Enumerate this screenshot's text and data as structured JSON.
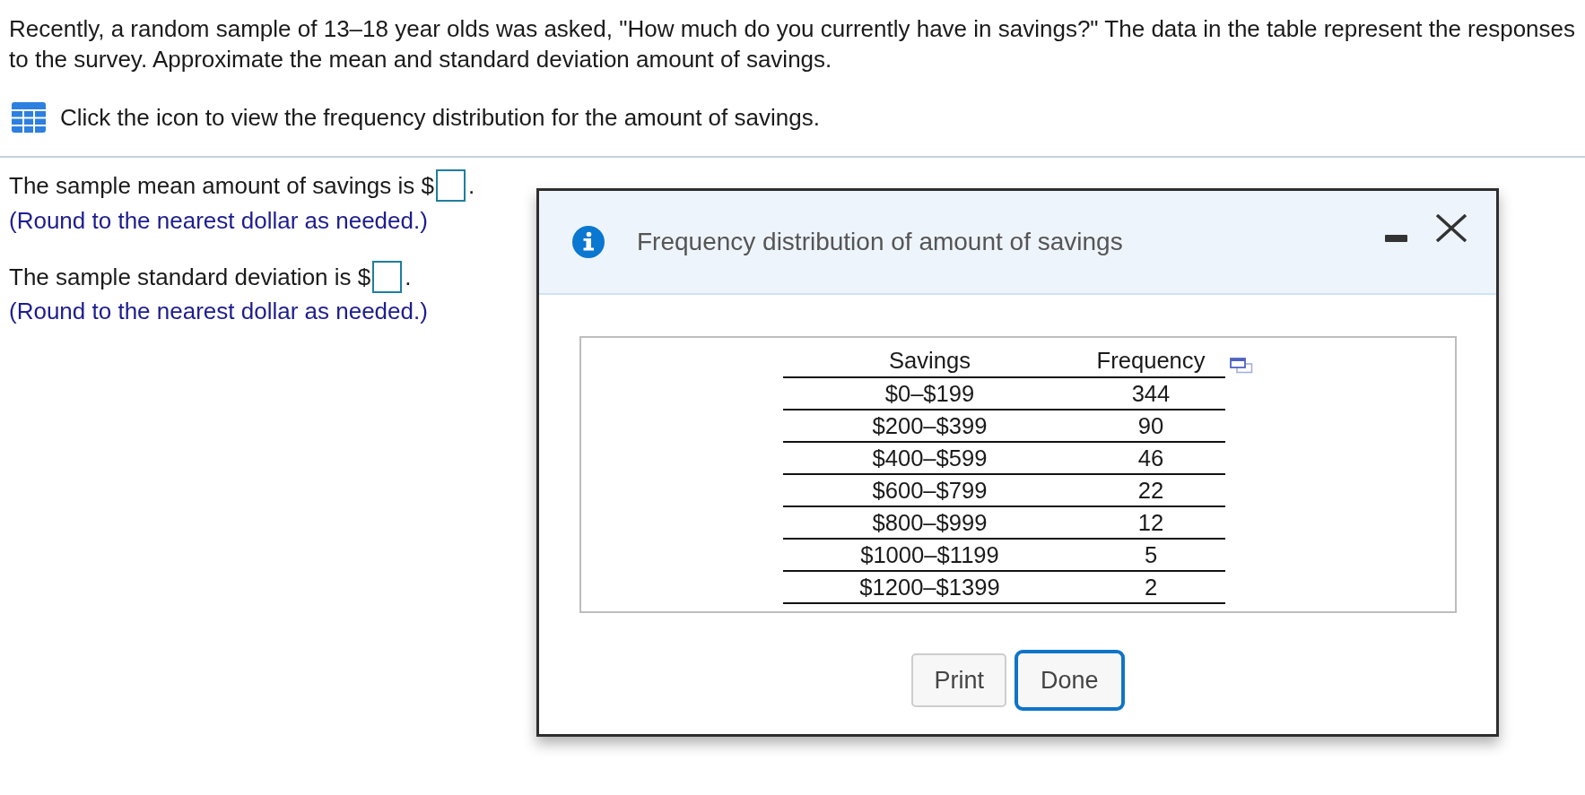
{
  "question": {
    "text": "Recently, a random sample of 13–18 year olds was asked, \"How much do you currently have in savings?\" The data in the table represent the responses to the survey. Approximate the mean and standard deviation amount of savings."
  },
  "table_link": {
    "text": "Click the icon to view the frequency distribution for the amount of savings."
  },
  "answers": [
    {
      "prompt": "The sample mean amount of savings is $",
      "suffix": ".",
      "hint": "(Round to the nearest dollar as needed.)"
    },
    {
      "prompt": "The sample standard deviation is $",
      "suffix": ".",
      "hint": "(Round to the nearest dollar as needed.)"
    }
  ],
  "dialog": {
    "title": "Frequency distribution of amount of savings",
    "table": {
      "columns": [
        "Savings",
        "Frequency"
      ],
      "rows": [
        [
          "$0–$199",
          "344"
        ],
        [
          "$200–$399",
          "90"
        ],
        [
          "$400–$599",
          "46"
        ],
        [
          "$600–$799",
          "22"
        ],
        [
          "$800–$999",
          "12"
        ],
        [
          "$1000–$1199",
          "5"
        ],
        [
          "$1200–$1399",
          "2"
        ]
      ]
    },
    "buttons": [
      {
        "label": "Print",
        "focused": false
      },
      {
        "label": "Done",
        "focused": true
      }
    ]
  }
}
